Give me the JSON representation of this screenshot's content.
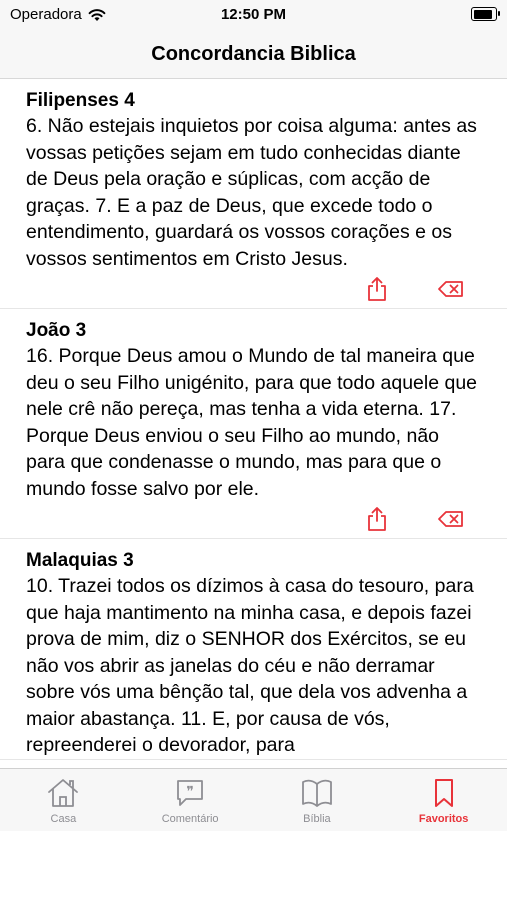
{
  "status": {
    "carrier": "Operadora",
    "time": "12:50 PM",
    "battery_level": 0.9
  },
  "header": {
    "title": "Concordancia Biblica"
  },
  "accent_color": "#e8333a",
  "verses": [
    {
      "reference": "Filipenses 4",
      "text": "6. Não estejais inquietos por coisa alguma: antes as vossas petições sejam em tudo conhecidas diante de Deus pela oração e súplicas, com acção de graças. 7. E a paz de Deus, que excede todo o entendimento, guardará os vossos corações e os vossos sentimentos em Cristo Jesus."
    },
    {
      "reference": "João 3",
      "text": "16. Porque Deus amou o Mundo de tal maneira que deu o seu Filho unigénito, para que todo aquele que nele crê não pereça, mas tenha a vida eterna. 17. Porque Deus enviou o seu Filho ao mundo, não para que condenasse o mundo, mas para que o mundo fosse salvo por ele."
    },
    {
      "reference": "Malaquias 3",
      "text": "10. Trazei todos os dízimos à casa do tesouro, para que haja mantimento na minha casa, e depois fazei prova de mim, diz o SENHOR dos Exércitos, se eu não vos abrir as janelas do céu e não derramar sobre vós uma bênção tal, que dela vos advenha a maior abastança. 11. E, por causa de vós, repreenderei o devorador, para"
    }
  ],
  "tabs": [
    {
      "label": "Casa",
      "icon": "house-icon"
    },
    {
      "label": "Comentário",
      "icon": "comment-icon"
    },
    {
      "label": "Bíblia",
      "icon": "book-icon"
    },
    {
      "label": "Favoritos",
      "icon": "bookmark-icon",
      "active": true
    }
  ]
}
